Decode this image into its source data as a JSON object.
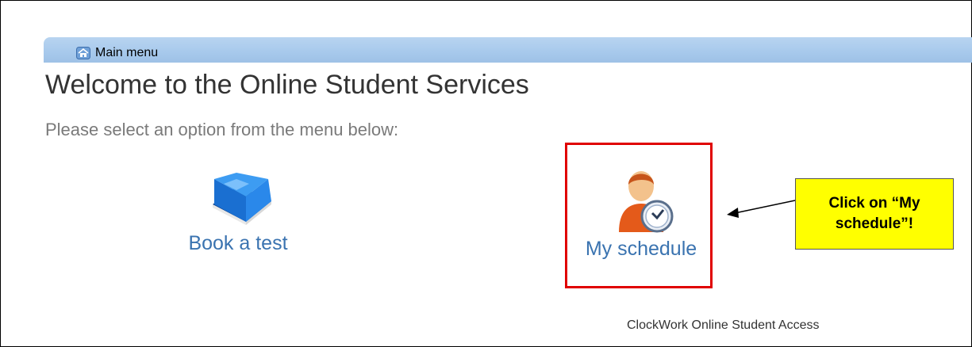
{
  "header": {
    "menu_label": "Main menu",
    "menu_icon": "house-icon"
  },
  "main": {
    "title": "Welcome to the Online Student Services",
    "subtitle": "Please select an option from the menu below:",
    "options": [
      {
        "label": "Book a test",
        "icon": "book-icon"
      },
      {
        "label": "My schedule",
        "icon": "person-clock-icon"
      }
    ]
  },
  "annotation": {
    "callout_text": "Click on “My schedule”!",
    "callout_color": "#ffff00",
    "highlight_color": "#e00000"
  },
  "footer": {
    "text": "ClockWork Online Student Access"
  }
}
